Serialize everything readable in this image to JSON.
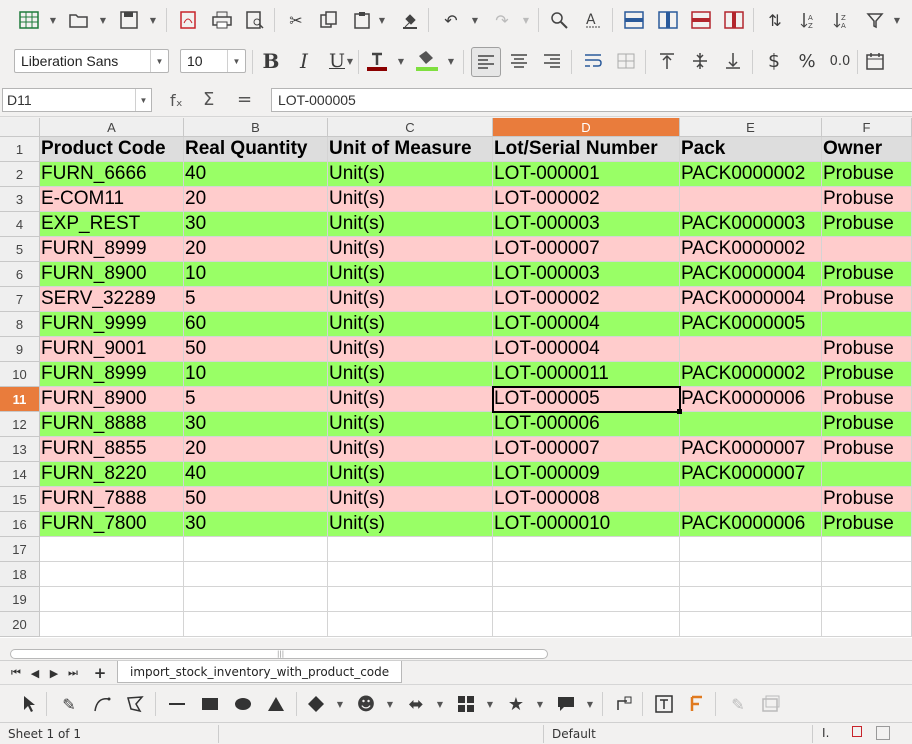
{
  "font": {
    "name": "Liberation Sans",
    "size": "10"
  },
  "namebox": {
    "value": "D11"
  },
  "formula": {
    "fx_symbol": "fₓ",
    "sum_symbol": "Σ",
    "eq_symbol": "=",
    "content": "LOT-000005"
  },
  "columns": [
    "A",
    "B",
    "C",
    "D",
    "E",
    "F"
  ],
  "rows": [
    "1",
    "2",
    "3",
    "4",
    "5",
    "6",
    "7",
    "8",
    "9",
    "10",
    "11",
    "12",
    "13",
    "14",
    "15",
    "16",
    "17",
    "18",
    "19",
    "20"
  ],
  "table": {
    "headers": [
      "Product Code",
      "Real Quantity",
      "Unit of Measure",
      "Lot/Serial Number",
      "Pack",
      "Owner"
    ],
    "records": [
      [
        "FURN_6666",
        "40",
        "Unit(s)",
        "LOT-000001",
        "PACK0000002",
        "Probuse"
      ],
      [
        "E-COM11",
        "20",
        "Unit(s)",
        "LOT-000002",
        "",
        "Probuse"
      ],
      [
        "EXP_REST",
        "30",
        "Unit(s)",
        "LOT-000003",
        "PACK0000003",
        "Probuse"
      ],
      [
        "FURN_8999",
        "20",
        "Unit(s)",
        "LOT-000007",
        "PACK0000002",
        ""
      ],
      [
        "FURN_8900",
        "10",
        "Unit(s)",
        "LOT-000003",
        "PACK0000004",
        "Probuse"
      ],
      [
        "SERV_32289",
        "5",
        "Unit(s)",
        "LOT-000002",
        "PACK0000004",
        "Probuse"
      ],
      [
        "FURN_9999",
        "60",
        "Unit(s)",
        "LOT-000004",
        "PACK0000005",
        ""
      ],
      [
        "FURN_9001",
        "50",
        "Unit(s)",
        "LOT-000004",
        "",
        "Probuse"
      ],
      [
        "FURN_8999",
        "10",
        "Unit(s)",
        "LOT-0000011",
        "PACK0000002",
        "Probuse"
      ],
      [
        "FURN_8900",
        "5",
        "Unit(s)",
        "LOT-000005",
        "PACK0000006",
        "Probuse"
      ],
      [
        "FURN_8888",
        "30",
        "Unit(s)",
        "LOT-000006",
        "",
        "Probuse"
      ],
      [
        "FURN_8855",
        "20",
        "Unit(s)",
        "LOT-000007",
        "PACK0000007",
        "Probuse"
      ],
      [
        "FURN_8220",
        "40",
        "Unit(s)",
        "LOT-000009",
        "PACK0000007",
        ""
      ],
      [
        "FURN_7888",
        "50",
        "Unit(s)",
        "LOT-000008",
        "",
        "Probuse"
      ],
      [
        "FURN_7800",
        "30",
        "Unit(s)",
        "LOT-0000010",
        "PACK0000006",
        "Probuse"
      ]
    ],
    "row_colors": [
      "green",
      "pink",
      "green",
      "pink",
      "green",
      "pink",
      "green",
      "pink",
      "green",
      "pink",
      "green",
      "pink",
      "green",
      "pink",
      "green"
    ]
  },
  "active": {
    "column": "D",
    "row": "11"
  },
  "colors": {
    "green": "#99ff66",
    "pink": "#ffcccc",
    "header": "#dddddd",
    "active_header": "#e97c3c"
  },
  "sheet_tab": {
    "label": "import_stock_inventory_with_product_code"
  },
  "status": {
    "sheet": "Sheet 1 of 1",
    "style": "Default"
  }
}
